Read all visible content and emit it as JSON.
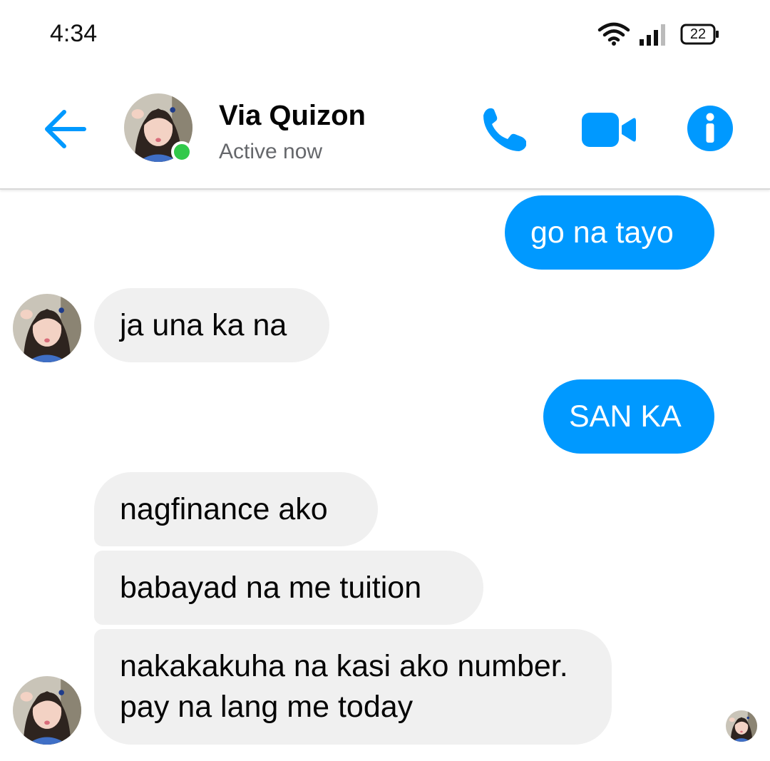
{
  "status_bar": {
    "time": "4:34",
    "battery_level": "22",
    "icons": [
      "wifi-icon",
      "signal-icon",
      "battery-icon"
    ]
  },
  "header": {
    "contact_name": "Via Quizon",
    "contact_status": "Active now",
    "icons": [
      "back-arrow-icon",
      "phone-icon",
      "video-camera-icon",
      "info-icon"
    ]
  },
  "colors": {
    "accent": "#0099ff",
    "incoming_bubble": "#f0f0f0",
    "online": "#31c94a",
    "status_text": "#65676b"
  },
  "messages": [
    {
      "direction": "outgoing",
      "text": "go na tayo"
    },
    {
      "direction": "incoming",
      "text": "ja una ka na"
    },
    {
      "direction": "outgoing",
      "text": "SAN KA"
    },
    {
      "direction": "incoming",
      "text": "nagfinance ako"
    },
    {
      "direction": "incoming",
      "text": "babayad na me tuition"
    },
    {
      "direction": "incoming",
      "text": "nakakakuha na kasi ako number. pay na lang me today"
    }
  ]
}
